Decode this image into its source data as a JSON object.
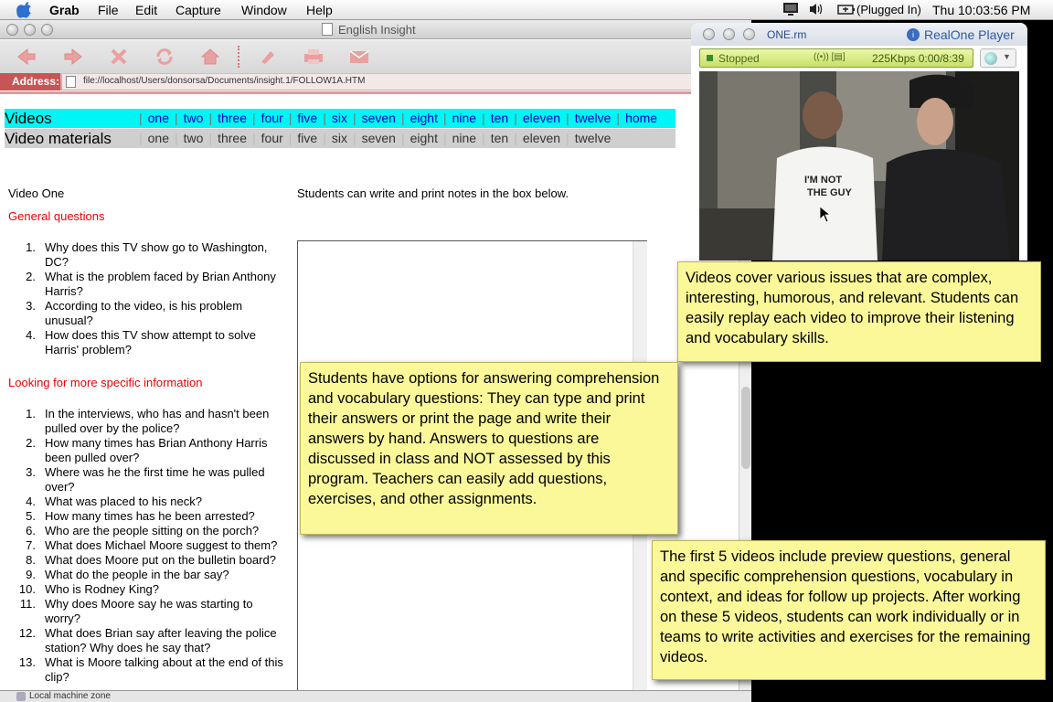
{
  "menubar": {
    "app_name": "Grab",
    "menus": [
      "File",
      "Edit",
      "Capture",
      "Window",
      "Help"
    ],
    "power_status": "(Plugged In)",
    "clock": "Thu 10:03:56 PM"
  },
  "browser": {
    "title": "English Insight",
    "address_label": "Address:",
    "url": "file://localhost/Users/donsorsa/Documents/insight.1/FOLLOW1A.HTM",
    "status_text": "Local machine zone"
  },
  "nav": {
    "videos_label": "Videos",
    "video_links": [
      "one",
      "two",
      "three",
      "four",
      "five",
      "six",
      "seven",
      "eight",
      "nine",
      "ten",
      "eleven",
      "twelve",
      "home"
    ],
    "materials_label": "Video materials",
    "material_links": [
      "one",
      "two",
      "three",
      "four",
      "five",
      "six",
      "seven",
      "eight",
      "nine",
      "ten",
      "eleven",
      "twelve"
    ]
  },
  "content": {
    "video_title": "Video One",
    "notes_instruction": "Students can write and print notes in the box below.",
    "general_heading": "General questions",
    "general_questions": [
      "Why does this TV show go to Washington, DC?",
      "What is the problem faced by Brian Anthony Harris?",
      "According to the video, is his problem unusual?",
      "How does this TV show attempt to solve Harris' problem?"
    ],
    "specific_heading": "Looking for more specific information",
    "specific_questions": [
      "In the interviews, who has and hasn't been pulled over by the police?",
      "How many times has Brian Anthony Harris been pulled over?",
      "Where was he the first time he was pulled over?",
      "What was placed to his neck?",
      "How many times has he been arrested?",
      "Who are the people sitting on the porch?",
      "What does Michael Moore suggest to them?",
      "What does Moore put on the bulletin board?",
      "What do the people in the bar say?",
      "Who is Rodney King?",
      "Why does Moore say he was starting to worry?",
      "What does Brian say after leaving the police station? Why does he say that?",
      "What is Moore talking about at the end of this clip?"
    ]
  },
  "player": {
    "title": "ONE.rm",
    "brand": "RealOne Player",
    "status": "Stopped",
    "rate": "225Kbps 0:00/8:39",
    "shirt_text": "I'M NOT THE GUY"
  },
  "callouts": {
    "video_info": "Videos cover various issues that are complex, interesting, humorous, and relevant.  Students can easily replay each video to improve their listening and vocabulary skills.",
    "answer_options": "Students have options for answering comprehension and vocabulary questions: They can type and print their answers or print the page and write their answers by hand. Answers to questions are discussed in class and NOT assessed by this program.  Teachers can easily add questions, exercises, and other assignments.",
    "first_five": "The first 5 videos include preview questions, general and specific comprehension questions, vocabulary in context, and ideas for follow up projects.  After working on these 5 videos, students can work individually or in teams to write activities and exercises for the remaining videos."
  },
  "colors": {
    "videos_nav_bg": "#00f5f5",
    "materials_nav_bg": "#cfcfcf",
    "heading_red": "#e00000",
    "callout_yellow": "#fbf89a",
    "address_bar_pink": "#d99c9c",
    "player_status_green": "#c8e06a"
  },
  "icons": [
    "apple-icon",
    "display-icon",
    "volume-icon",
    "battery-icon",
    "back-icon",
    "forward-icon",
    "stop-icon",
    "refresh-icon",
    "home-icon",
    "autofill-icon",
    "print-icon",
    "mail-icon",
    "document-icon",
    "realone-logo-icon",
    "globe-icon",
    "mouse-cursor-icon"
  ]
}
